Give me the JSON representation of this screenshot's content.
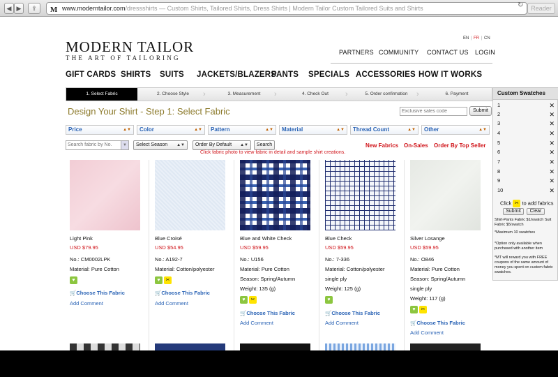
{
  "browser": {
    "url_host": "www.moderntailor.com",
    "url_path": "/dressshirts",
    "page_title": "Custom Shirts, Tailored Shirts, Dress Shirts | Modern Tailor Custom Tailored Suits and Shirts",
    "favicon_letter": "M",
    "reader_label": "Reader"
  },
  "header": {
    "logo_title": "MODERN TAILOR",
    "logo_tagline": "THE ART OF TAILORING",
    "languages": [
      "EN",
      "FR",
      "CN"
    ],
    "top_links": [
      "PARTNERS",
      "COMMUNITY",
      "CONTACT US",
      "LOGIN"
    ]
  },
  "main_nav": [
    "GIFT CARDS",
    "SHIRTS",
    "SUITS",
    "JACKETS/BLAZERS",
    "PANTS",
    "SPECIALS",
    "ACCESSORIES",
    "HOW IT WORKS"
  ],
  "steps": [
    "1. Select Fabric",
    "2. Choose Style",
    "3. Measurement",
    "4. Check Out",
    "5. Order confirmation",
    "6. Payment"
  ],
  "page": {
    "title": "Design Your Shirt - Step 1: Select Fabric",
    "sales_placeholder": "Exclusive sales code",
    "submit_label": "Submit",
    "hint": "Click fabric photo to view fabric in detail and sample shirt creations."
  },
  "filters": [
    "Price",
    "Color",
    "Pattern",
    "Material",
    "Thread Count",
    "Other"
  ],
  "controls": {
    "search_placeholder": "Search fabric by No.",
    "season": "Select Season",
    "order": "Order By Default",
    "search_button": "Search",
    "sort_links": [
      "New Fabrics",
      "On-Sales",
      "Order By Top Seller"
    ]
  },
  "products": [
    {
      "name": "Light Pink",
      "price": "USD $79.95",
      "no": "No.: CM0002LPK",
      "material": "Material: Pure Cotton",
      "extra": [],
      "scissors": false
    },
    {
      "name": "Blue Croisé",
      "price": "USD $54.95",
      "no": "No.: A192-7",
      "material": "Material: Cotton/polyester",
      "extra": [],
      "scissors": true
    },
    {
      "name": "Blue and White Check",
      "price": "USD $59.95",
      "no": "No.: U156",
      "material": "Material: Pure Cotton",
      "extra": [
        "Season: Spring/Autumn",
        "Weight: 135 (g)"
      ],
      "scissors": true
    },
    {
      "name": "Blue Check",
      "price": "USD $59.95",
      "no": "No.: 7-336",
      "material": "Material: Cotton/polyester",
      "extra": [
        "single ply",
        "Weight: 125 (g)"
      ],
      "scissors": false
    },
    {
      "name": "Silver Losange",
      "price": "USD $59.95",
      "no": "No.: O846",
      "material": "Material: Pure Cotton",
      "extra": [
        "Season: Spring/Autumn",
        "single ply",
        "Weight: 117 (g)"
      ],
      "scissors": true
    }
  ],
  "product_actions": {
    "choose": "Choose This Fabric",
    "comment": "Add Comment"
  },
  "sidebar": {
    "title": "Custom Swatches",
    "slots": [
      "1",
      "2",
      "3",
      "4",
      "5",
      "6",
      "7",
      "8",
      "9",
      "10"
    ],
    "click_prefix": "Click",
    "click_suffix": "to add fabrics",
    "submit": "Submit",
    "clear": "Clear",
    "notes": [
      "Shirt-Pants Fabric $1/swatch Suit Fabric $5/swatch",
      "*Maximum 10 swatches",
      "*Option only available when purchased with another item",
      "*MT will reward you with FREE coupons of the same amount of money you spent on custom fabric swatches."
    ]
  },
  "colors": {
    "accent_blue": "#2a63b5",
    "sale_red": "#d0141a",
    "title_gold": "#8c7a2b"
  },
  "icons": [
    "back-icon",
    "forward-icon",
    "share-icon",
    "add-tab-icon",
    "reload-icon",
    "heart-icon",
    "scissors-icon",
    "cart-icon",
    "remove-icon"
  ]
}
